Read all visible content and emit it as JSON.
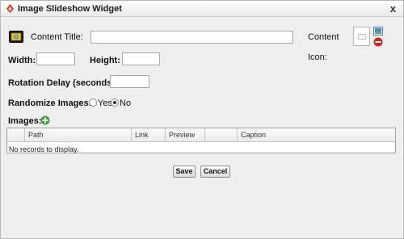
{
  "window": {
    "title": "Image Slideshow Widget",
    "close_glyph": "x"
  },
  "form": {
    "content_title_label": "Content Title:",
    "content_title_value": "",
    "content_icon_label_1": "Content",
    "content_icon_label_2": "Icon:",
    "width_label": "Width:",
    "width_value": "",
    "height_label": "Height:",
    "height_value": "",
    "rotation_delay_label": "Rotation Delay (seconds):",
    "rotation_delay_value": "",
    "randomize_label": "Randomize Images:",
    "randomize_options": [
      {
        "label": "Yes",
        "selected": false
      },
      {
        "label": "No",
        "selected": true
      }
    ],
    "images_label": "Images:"
  },
  "grid": {
    "columns": [
      "Path",
      "Link",
      "Preview",
      "",
      "Caption"
    ],
    "empty_text": "No records to display."
  },
  "actions": {
    "save_label": "Save",
    "cancel_label": "Cancel"
  },
  "colors": {
    "accent_green": "#3aa33a",
    "remove_red": "#cc2222",
    "title_icon_red": "#c0392b"
  }
}
